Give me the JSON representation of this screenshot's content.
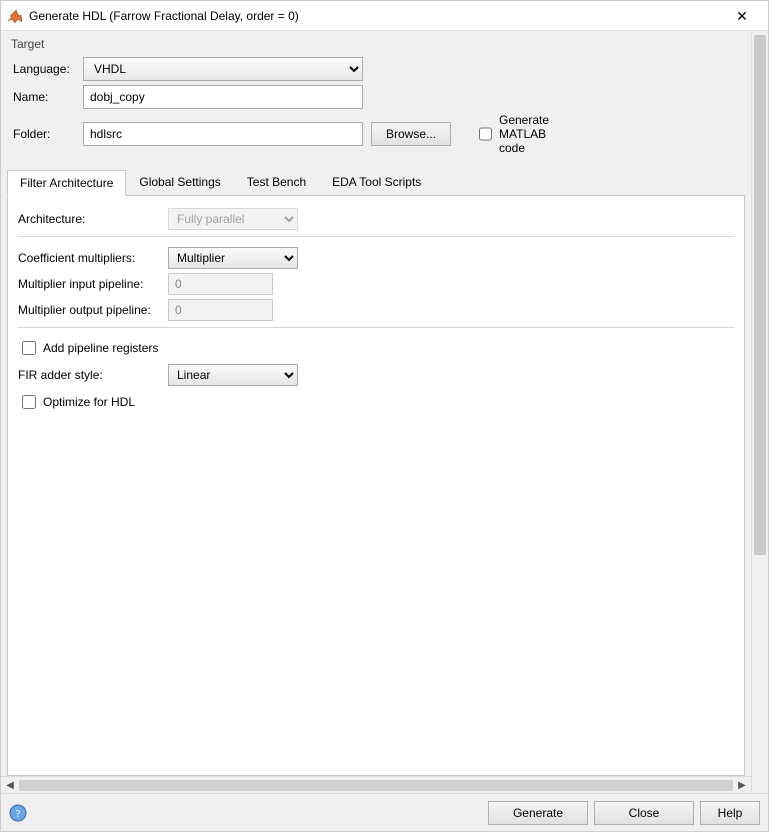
{
  "window": {
    "title": "Generate HDL (Farrow Fractional Delay, order = 0)"
  },
  "target": {
    "legend": "Target",
    "language_label": "Language:",
    "language_value": "VHDL",
    "name_label": "Name:",
    "name_value": "dobj_copy",
    "folder_label": "Folder:",
    "folder_value": "hdlsrc",
    "browse_label": "Browse...",
    "gen_matlab_label": "Generate MATLAB code"
  },
  "tabs": {
    "filter_architecture": "Filter Architecture",
    "global_settings": "Global Settings",
    "test_bench": "Test Bench",
    "eda_tool_scripts": "EDA Tool Scripts"
  },
  "filter_arch": {
    "architecture_label": "Architecture:",
    "architecture_value": "Fully parallel",
    "coeff_mult_label": "Coefficient multipliers:",
    "coeff_mult_value": "Multiplier",
    "mult_input_label": "Multiplier input pipeline:",
    "mult_input_value": "0",
    "mult_output_label": "Multiplier output pipeline:",
    "mult_output_value": "0",
    "add_pipeline_label": "Add pipeline registers",
    "fir_adder_label": "FIR adder style:",
    "fir_adder_value": "Linear",
    "optimize_label": "Optimize for HDL"
  },
  "footer": {
    "generate": "Generate",
    "close": "Close",
    "help": "Help"
  }
}
